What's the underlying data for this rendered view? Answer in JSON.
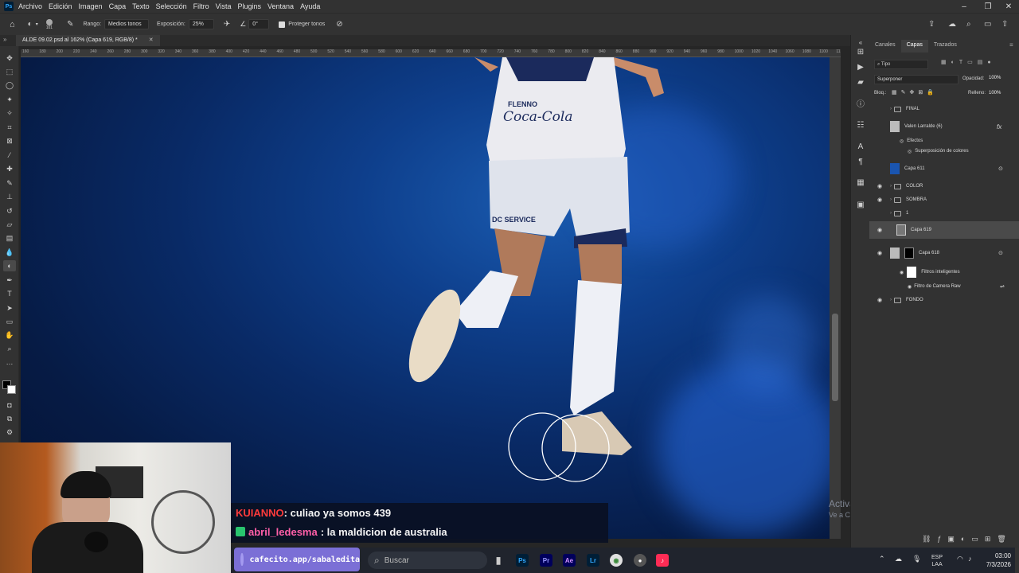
{
  "app": {
    "menu": [
      "Archivo",
      "Edición",
      "Imagen",
      "Capa",
      "Texto",
      "Selección",
      "Filtro",
      "Vista",
      "Plugins",
      "Ventana",
      "Ayuda"
    ]
  },
  "options": {
    "brush_size": "101",
    "range_label": "Rango:",
    "range_value": "Medios tonos",
    "exposure_label": "Exposición:",
    "exposure_value": "25%",
    "angle_value": "0°",
    "protect_label": "Proteger tonos"
  },
  "document": {
    "tab_title": "ALDE 09.02.psd al 162% (Capa 619, RGB/8) *"
  },
  "ruler_ticks": [
    "160",
    "180",
    "200",
    "220",
    "240",
    "260",
    "280",
    "300",
    "320",
    "340",
    "360",
    "380",
    "400",
    "420",
    "440",
    "460",
    "480",
    "500",
    "520",
    "540",
    "560",
    "580",
    "600",
    "620",
    "640",
    "660",
    "680",
    "700",
    "720",
    "740",
    "760",
    "780",
    "800",
    "820",
    "840",
    "860",
    "880",
    "900",
    "920",
    "940",
    "960",
    "980",
    "1000",
    "1020",
    "1040",
    "1060",
    "1080",
    "1100",
    "1120"
  ],
  "canvas": {
    "jersey_text_1": "FLENNO",
    "jersey_text_2": "Coca-Cola",
    "shorts_text": "DC SERVICE"
  },
  "panel": {
    "tabs": [
      "Canales",
      "Capas",
      "Trazados"
    ],
    "active_tab": "Capas",
    "filter_kind": "Tipo",
    "blend_mode": "Superponer",
    "opacity_label": "Opacidad:",
    "opacity_value": "100%",
    "lock_label": "Bloq.:",
    "fill_label": "Relleno:",
    "fill_value": "100%",
    "layers": [
      {
        "name": "FINAL",
        "type": "folder",
        "visible": false
      },
      {
        "name": "Valen Larralde (6)",
        "type": "layer",
        "visible": false,
        "fx": "fx"
      },
      {
        "name": "Efectos",
        "type": "effect-group"
      },
      {
        "name": "Superposición de colores",
        "type": "effect"
      },
      {
        "name": "Capa 611",
        "type": "layer",
        "visible": false
      },
      {
        "name": "COLOR",
        "type": "folder",
        "visible": true
      },
      {
        "name": "SOMBRA",
        "type": "folder",
        "visible": true
      },
      {
        "name": "1",
        "type": "folder",
        "visible": false
      },
      {
        "name": "Capa 619",
        "type": "layer",
        "visible": true,
        "selected": true
      },
      {
        "name": "Capa 618",
        "type": "layer",
        "visible": true
      },
      {
        "name": "Filtros inteligentes",
        "type": "smart-filters"
      },
      {
        "name": "Filtro de Camera Raw",
        "type": "filter"
      },
      {
        "name": "FONDO",
        "type": "folder",
        "visible": true
      }
    ]
  },
  "chat": [
    {
      "user": "KUIANNO",
      "user_color": "#ff3b3b",
      "message": ": culiao ya somos 439"
    },
    {
      "user": "abril_ledesma",
      "user_color": "#ff5fa8",
      "message": ": la maldicion de australia"
    }
  ],
  "overlay": {
    "cafecito": "cafecito.app/sabaledita",
    "watermark_title": "Activar Windows",
    "watermark_sub": "Ve a Configuración para activar Windows."
  },
  "taskbar": {
    "search_placeholder": "Buscar",
    "lang_1": "ESP",
    "lang_2": "LAA",
    "time": "03:00",
    "date": "7/3/2026"
  },
  "colors": {
    "accent": "#31a8ff",
    "canvas_blue": "#0e3f8c",
    "cafecito": "#7b6fd6"
  }
}
